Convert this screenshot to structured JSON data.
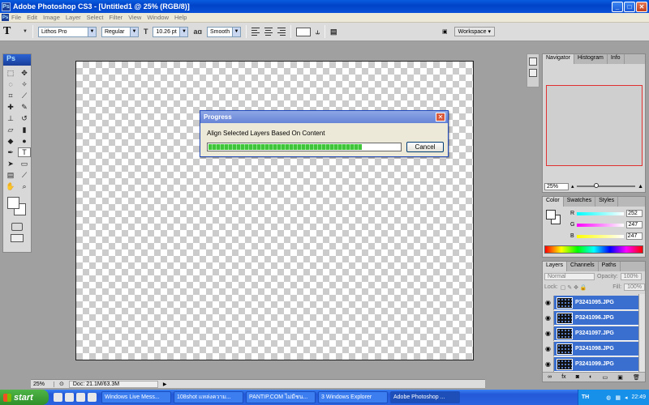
{
  "window": {
    "title": "Adobe Photoshop CS3 - [Untitled1 @ 25% (RGB/8)]",
    "app_badge": "Ps"
  },
  "menu": [
    "File",
    "Edit",
    "Image",
    "Layer",
    "Select",
    "Filter",
    "View",
    "Window",
    "Help"
  ],
  "options_bar": {
    "tool_glyph": "T",
    "font_family": "Lithos Pro",
    "font_style": "Regular",
    "font_size": "10.26 pt",
    "aa_label": "aɑ",
    "anti_alias": "Smooth",
    "workspace_label": "Workspace"
  },
  "toolbox": {
    "logo": "Ps"
  },
  "dialog": {
    "title": "Progress",
    "message": "Align Selected Layers Based On Content",
    "progress": 0.8,
    "cancel_label": "Cancel"
  },
  "status": {
    "zoom": "25%",
    "doc": "Doc: 21.1M/63.3M"
  },
  "navigator": {
    "tabs": [
      "Navigator",
      "Histogram",
      "Info"
    ],
    "zoom": "25%"
  },
  "color_panel": {
    "tabs": [
      "Color",
      "Swatches",
      "Styles"
    ],
    "channels": [
      {
        "label": "R",
        "value": "252",
        "color": "#ff4040"
      },
      {
        "label": "G",
        "value": "247",
        "color": "#40ff40"
      },
      {
        "label": "B",
        "value": "247",
        "color": "#4040ff"
      }
    ]
  },
  "layers_panel": {
    "tabs": [
      "Layers",
      "Channels",
      "Paths"
    ],
    "blend_mode": "Normal",
    "opacity_label": "Opacity:",
    "opacity": "100%",
    "lock_label": "Lock:",
    "fill_label": "Fill:",
    "fill": "100%",
    "layers": [
      "P3241095.JPG",
      "P3241096.JPG",
      "P3241097.JPG",
      "P3241098.JPG",
      "P3241099.JPG"
    ],
    "footer_icons": [
      "link",
      "fx",
      "mask",
      "adjust",
      "group",
      "new",
      "trash"
    ]
  },
  "taskbar": {
    "start_label": "start",
    "tasks": [
      "Windows Live Mess...",
      "108shot แหล่งความ...",
      "PANTIP.COM ไม่มีชน...",
      "3 Windows Explorer",
      "Adobe Photoshop ..."
    ],
    "lang": "TH",
    "clock": "22:49"
  },
  "colors": {
    "selection_blue": "#3a6fcf",
    "progress_green": "#3fc43a",
    "xp_blue": "#2459d8"
  }
}
